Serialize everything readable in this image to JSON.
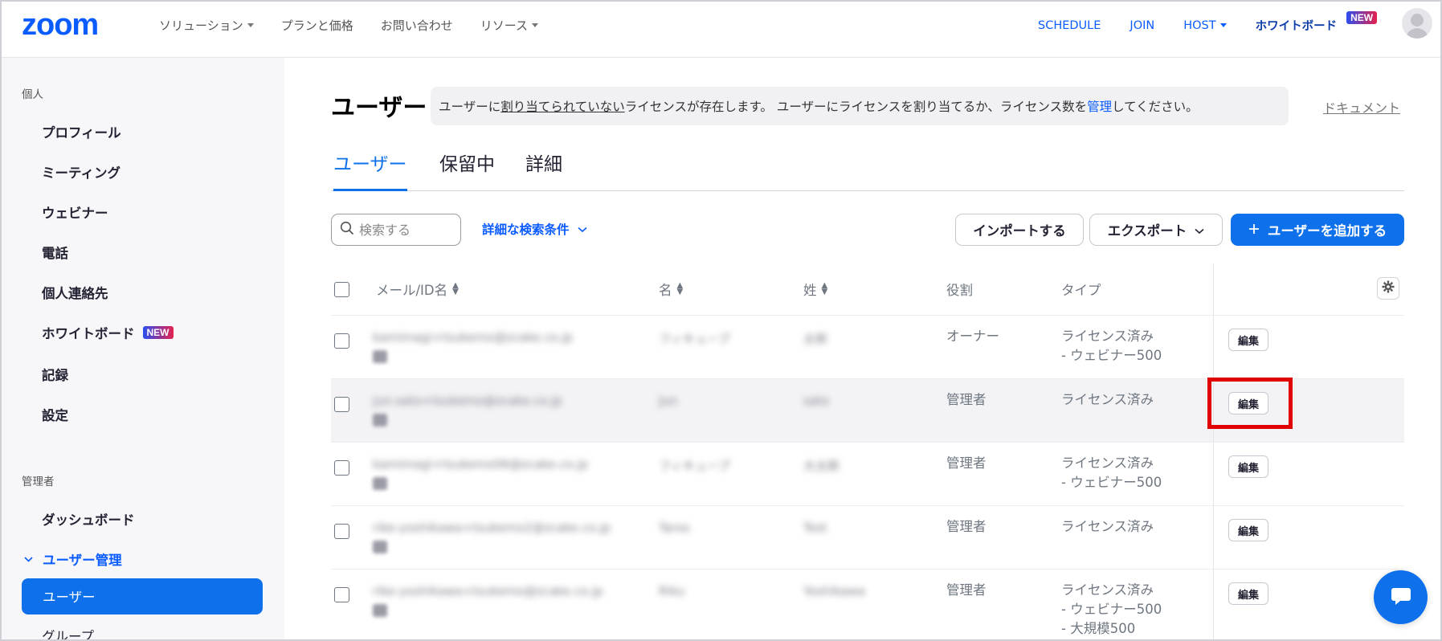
{
  "topnav": {
    "logo": "zoom",
    "left_items": [
      "ソリューション",
      "プランと価格",
      "お問い合わせ",
      "リソース"
    ],
    "right_items": {
      "schedule": "SCHEDULE",
      "join": "JOIN",
      "host": "HOST",
      "whiteboard": "ホワイトボード",
      "new_badge": "NEW"
    }
  },
  "sidebar": {
    "personal_header": "個人",
    "personal_items": [
      "プロフィール",
      "ミーティング",
      "ウェビナー",
      "電話",
      "個人連絡先",
      "ホワイトボード",
      "記録",
      "設定"
    ],
    "new_badge": "NEW",
    "admin_header": "管理者",
    "dashboard": "ダッシュボード",
    "user_management": "ユーザー管理",
    "users_active": "ユーザー",
    "groups": "グループ"
  },
  "main": {
    "title": "ユーザー",
    "notice": {
      "part1": "ユーザーに",
      "link_unassigned": "割り当てられていない",
      "part2": "ライセンスが存在します。 ユーザーにライセンスを割り当てるか、ライセンス数を",
      "link_manage": "管理",
      "part3": "してください。"
    },
    "doc_link": "ドキュメント",
    "tabs": [
      "ユーザー",
      "保留中",
      "詳細"
    ],
    "search_placeholder": "検索する",
    "advanced_search": "詳細な検索条件",
    "import_button": "インポートする",
    "export_button": "エクスポート",
    "add_user_button": "ユーザーを追加する",
    "table": {
      "headers": {
        "email": "メール/ID名",
        "first": "名",
        "last": "姓",
        "role": "役割",
        "type": "タイプ"
      },
      "edit_label": "編集",
      "rows": [
        {
          "email": "kamimagi+tsukemo@zcake.co.jp",
          "first": "フィキュープ",
          "last": "太郎",
          "role": "オーナー",
          "type": [
            "ライセンス済み",
            "- ウェビナー500"
          ]
        },
        {
          "email": "jun-sato+tsukemo@zcake.co.jp",
          "first": "Jun",
          "last": "sato",
          "role": "管理者",
          "type": [
            "ライセンス済み"
          ]
        },
        {
          "email": "kamimagi+tsukemo06@zcake.co.jp",
          "first": "フィキュープ",
          "last": "大太郎",
          "role": "管理者",
          "type": [
            "ライセンス済み",
            "- ウェビナー500"
          ]
        },
        {
          "email": "rike-yoshikawa+tsukemo2@zcake.co.jp",
          "first": "Taros",
          "last": "Test",
          "role": "管理者",
          "type": [
            "ライセンス済み"
          ]
        },
        {
          "email": "rike-yoshikawa+tsukemo@zcake.co.jp",
          "first": "Riku",
          "last": "Yoshikawa",
          "role": "管理者",
          "type": [
            "ライセンス済み",
            "- ウェビナー500",
            "- 大規模500"
          ]
        }
      ]
    }
  },
  "colors": {
    "brand": "#0b5cff",
    "primary": "#0e71eb",
    "highlight": "#e00000"
  }
}
